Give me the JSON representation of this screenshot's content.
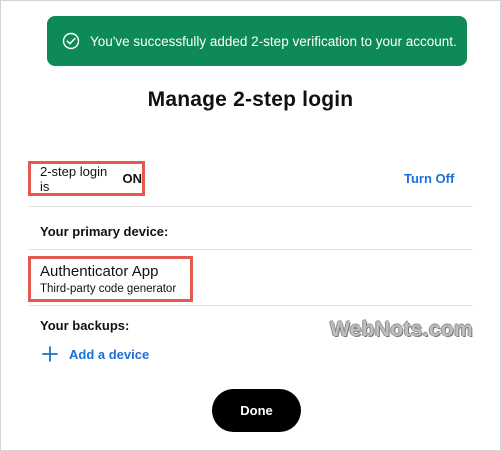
{
  "toast": {
    "icon": "check-circle-icon",
    "message": "You've successfully added 2-step verification to your account.",
    "color": "#0e8a57"
  },
  "page": {
    "title": "Manage 2-step login"
  },
  "status": {
    "label": "2-step login is",
    "value": "ON",
    "turn_off_label": "Turn Off"
  },
  "primary": {
    "section_label": "Your primary device:",
    "device_name": "Authenticator App",
    "device_description": "Third-party code generator"
  },
  "backups": {
    "section_label": "Your backups:",
    "add_icon": "plus-icon",
    "add_label": "Add a device"
  },
  "watermark": {
    "text": "WebNots.com"
  },
  "actions": {
    "done_label": "Done"
  },
  "colors": {
    "accent_link": "#1b6fd6",
    "highlight_border": "#e5584f",
    "primary_button": "#000000"
  }
}
